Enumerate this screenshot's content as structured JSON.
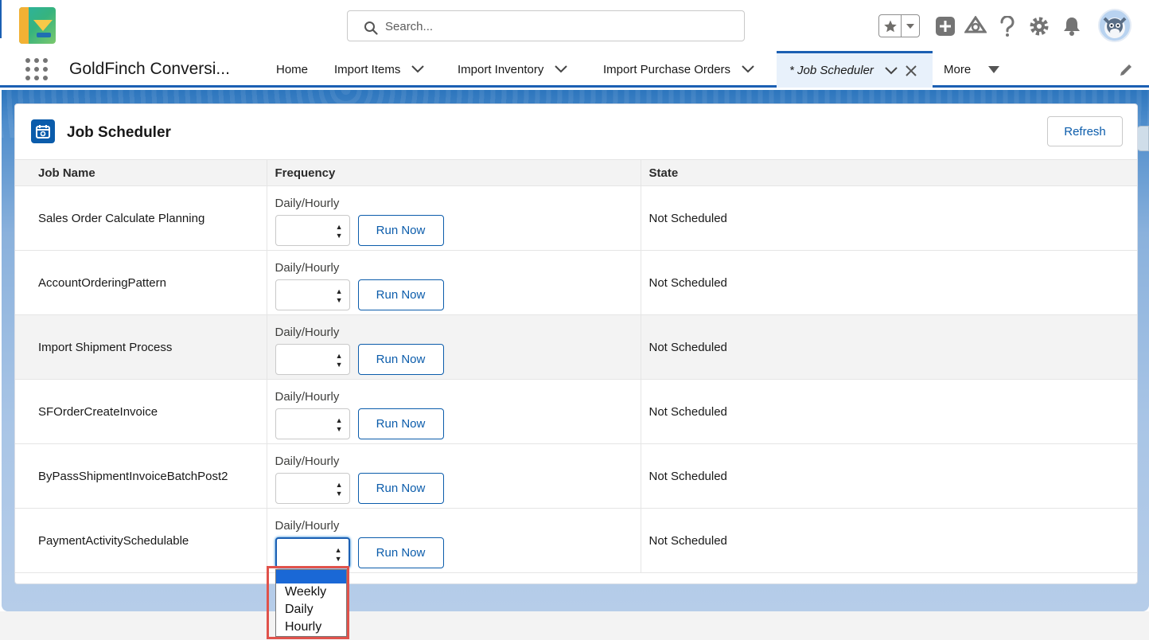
{
  "header": {
    "search_placeholder": "Search...",
    "icons": [
      "favorites-star-icon",
      "add-icon",
      "trailhead-icon",
      "help-icon",
      "setup-gear-icon",
      "notification-bell-icon",
      "user-avatar"
    ]
  },
  "nav": {
    "app_name": "GoldFinch Conversi...",
    "items": [
      {
        "label": "Home",
        "has_menu": false
      },
      {
        "label": "Import Items",
        "has_menu": true
      },
      {
        "label": "Import Inventory",
        "has_menu": true
      },
      {
        "label": "Import Purchase Orders",
        "has_menu": true
      }
    ],
    "active_tab": "* Job Scheduler",
    "more_label": "More"
  },
  "card": {
    "title": "Job Scheduler",
    "refresh_label": "Refresh",
    "columns": [
      "Job Name",
      "Frequency",
      "State"
    ],
    "frequency_label": "Daily/Hourly",
    "run_now_label": "Run Now",
    "rows": [
      {
        "job_name": "Sales Order Calculate Planning",
        "frequency": "",
        "state": "Not Scheduled"
      },
      {
        "job_name": "AccountOrderingPattern",
        "frequency": "",
        "state": "Not Scheduled"
      },
      {
        "job_name": "Import Shipment Process",
        "frequency": "",
        "state": "Not Scheduled"
      },
      {
        "job_name": "SFOrderCreateInvoice",
        "frequency": "",
        "state": "Not Scheduled"
      },
      {
        "job_name": "ByPassShipmentInvoiceBatchPost2",
        "frequency": "",
        "state": "Not Scheduled"
      },
      {
        "job_name": "PaymentActivitySchedulable",
        "frequency": "",
        "state": "Not Scheduled"
      }
    ]
  },
  "dropdown": {
    "options": [
      "",
      "Weekly",
      "Daily",
      "Hourly"
    ],
    "selected_index": 0
  },
  "colors": {
    "brand_blue": "#1b5fb3",
    "button_text": "#0b5cab",
    "dropdown_selected": "#1a68d6",
    "highlight_box": "#e0524b"
  }
}
